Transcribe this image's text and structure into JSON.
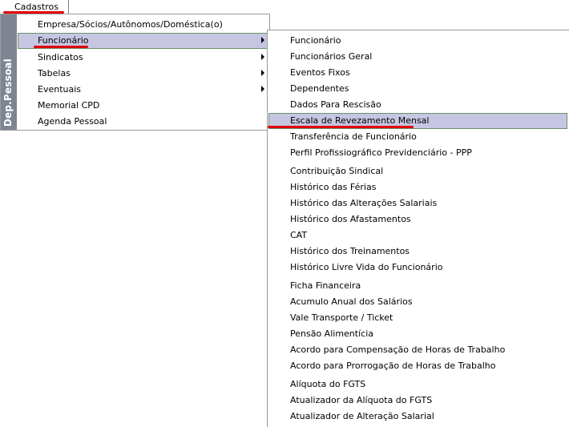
{
  "menubar": {
    "cadastros": "Cadastros"
  },
  "side_band": {
    "label": "Dep.Pessoal"
  },
  "menu1": {
    "items": [
      {
        "label": "Empresa/Sócios/Autônomos/Doméstica(o)",
        "submenu": false
      },
      {
        "label": "Funcionário",
        "submenu": true
      },
      {
        "label": "Sindicatos",
        "submenu": true
      },
      {
        "label": "Tabelas",
        "submenu": true
      },
      {
        "label": "Eventuais",
        "submenu": true
      },
      {
        "label": "Memorial CPD",
        "submenu": false
      },
      {
        "label": "Agenda Pessoal",
        "submenu": false
      }
    ],
    "active_item": "Funcionário"
  },
  "menu2": {
    "items": [
      {
        "label": "Funcionário"
      },
      {
        "label": "Funcionários Geral"
      },
      {
        "label": "Eventos Fixos"
      },
      {
        "label": "Dependentes"
      },
      {
        "label": "Dados Para  Rescisão"
      },
      {
        "label": "Escala de Revezamento Mensal"
      },
      {
        "label": "Transferência de Funcionário"
      },
      {
        "label": "Perfil Profissiográfico Previdenciário - PPP"
      },
      {
        "label": "Contribuição Sindical"
      },
      {
        "label": "Histórico das Férias"
      },
      {
        "label": "Histórico das Alterações  Salariais"
      },
      {
        "label": "Histórico dos Afastamentos"
      },
      {
        "label": "CAT"
      },
      {
        "label": "Histórico dos Treinamentos"
      },
      {
        "label": "Histórico Livre Vida do Funcionário"
      },
      {
        "label": "Ficha Financeira"
      },
      {
        "label": "Acumulo Anual dos Salários"
      },
      {
        "label": "Vale Transporte / Ticket"
      },
      {
        "label": "Pensão Alimentícia"
      },
      {
        "label": "Acordo para Compensação de Horas de Trabalho"
      },
      {
        "label": "Acordo para Prorrogação de Horas de Trabalho"
      },
      {
        "label": "Alíquota do FGTS"
      },
      {
        "label": "Atualizador da Alíquota do FGTS"
      },
      {
        "label": "Atualizador de Alteração Salarial"
      }
    ],
    "active_item": "Escala de Revezamento Mensal"
  },
  "colors": {
    "highlight": "#c6c6e2",
    "highlight_border": "#6b8f6b",
    "annotation": "#e00000",
    "side_band": "#7f8590"
  }
}
